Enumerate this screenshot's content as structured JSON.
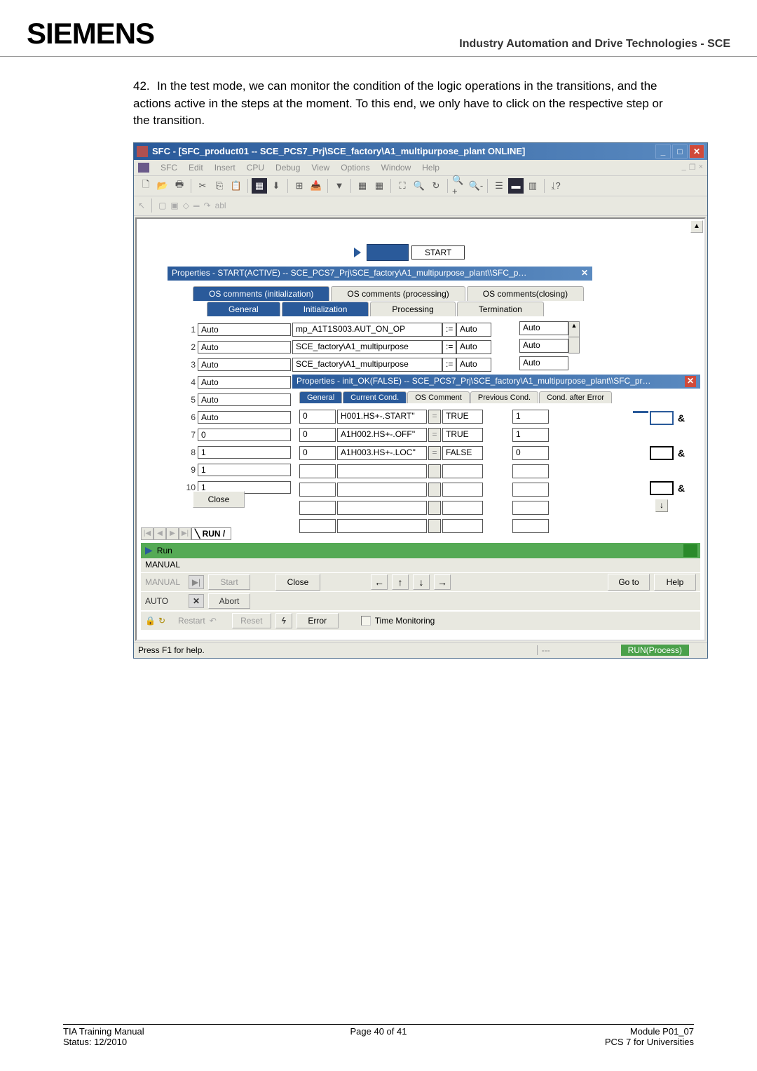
{
  "header": {
    "logo": "SIEMENS",
    "text": "Industry Automation and Drive Technologies - SCE"
  },
  "body": {
    "num": "42.",
    "text": "In the test mode, we can monitor the condition of the logic operations in the transitions, and the actions active in the steps at the moment. To this end, we only have to click on the respective step or the transition."
  },
  "window": {
    "title": "SFC - [SFC_product01 -- SCE_PCS7_Prj\\SCE_factory\\A1_multipurpose_plant ONLINE]",
    "menu": [
      "SFC",
      "Edit",
      "Insert",
      "CPU",
      "Debug",
      "View",
      "Options",
      "Window",
      "Help"
    ],
    "toolbar2": "abl",
    "start_label": "START",
    "props1": "Properties - START(ACTIVE) -- SCE_PCS7_Prj\\SCE_factory\\A1_multipurpose_plant\\\\SFC_p…",
    "tabs": [
      "OS comments (initialization)",
      "OS comments (processing)",
      "OS comments(closing)"
    ],
    "tabs2": [
      "General",
      "Initialization",
      "Processing",
      "Termination"
    ],
    "steps": {
      "r1": "Auto",
      "r2": "Auto",
      "r3": "Auto",
      "r4": "Auto",
      "r5": "Auto",
      "r6": "Auto",
      "r7": "0",
      "r8": "1",
      "r9": "1",
      "r10": "1"
    },
    "actions": {
      "a1a": "mp_A1T1S003.AUT_ON_OP",
      "a1b": ":=",
      "a1c": "Auto",
      "a2a": "SCE_factory\\A1_multipurpose",
      "a2b": ":=",
      "a2c": "Auto",
      "a3a": "SCE_factory\\A1_multipurpose",
      "a3b": ":=",
      "a3c": "Auto"
    },
    "auto": {
      "a1": "Auto",
      "a2": "Auto",
      "a3": "Auto"
    },
    "props2": "Properties - init_OK(FALSE) -- SCE_PCS7_Prj\\SCE_factory\\A1_multipurpose_plant\\\\SFC_pr…",
    "tabs3": [
      "General",
      "Current Cond.",
      "OS Comment",
      "Previous Cond.",
      "Cond. after Error"
    ],
    "grid": {
      "r1": {
        "a": "0",
        "b": "H001.HS+-.START''",
        "c": "=",
        "d": "TRUE",
        "e": "1"
      },
      "r2": {
        "a": "0",
        "b": "A1H002.HS+-.OFF''",
        "c": "=",
        "d": "TRUE",
        "e": "1"
      },
      "r3": {
        "a": "0",
        "b": "A1H003.HS+-.LOC''",
        "c": "=",
        "d": "FALSE",
        "e": "0"
      }
    },
    "amp": "&",
    "close": "Close",
    "run_tab": "RUN",
    "run": "Run",
    "manual": "MANUAL",
    "ctrl": {
      "manual": "MANUAL",
      "start": "Start",
      "auto": "AUTO",
      "abort": "Abort",
      "close": "Close",
      "goto": "Go to",
      "help": "Help",
      "restart": "Restart",
      "reset": "Reset",
      "error": "Error",
      "time": "Time Monitoring"
    },
    "status": {
      "left": "Press F1 for help.",
      "mid": "---",
      "run": "RUN(Process)"
    }
  },
  "footer": {
    "l1l": "TIA Training Manual",
    "l1c": "Page 40 of 41",
    "l1r": "Module P01_07",
    "l2l": "Status: 12/2010",
    "l2r": "PCS 7 for Universities"
  }
}
